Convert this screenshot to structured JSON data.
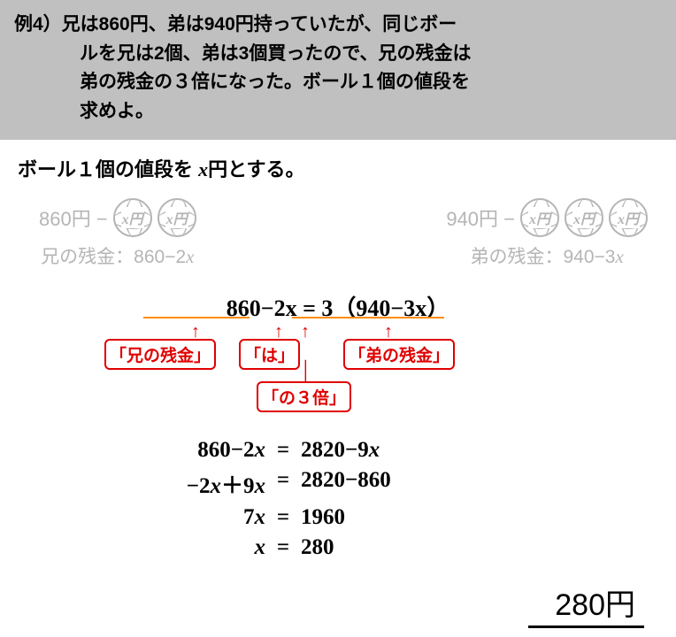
{
  "problem": {
    "label": "例4）",
    "line1": "兄は860円、弟は940円持っていたが、同じボー",
    "line2": "ルを兄は2個、弟は3個買ったので、兄の残金は",
    "line3": "弟の残金の３倍になった。ボール１個の値段を",
    "line4": "求めよ。"
  },
  "let": {
    "prefix": "ボール１個の値段を ",
    "var": "x",
    "suffix": "円とする。"
  },
  "diagram": {
    "left": {
      "start": "860円 −",
      "balls": [
        "x円",
        "x円"
      ],
      "label_pre": "兄の残金：860−2",
      "label_var": "x"
    },
    "right": {
      "start": "940円 −",
      "balls": [
        "x円",
        "x円",
        "x円"
      ],
      "label_pre": "弟の残金：940−3",
      "label_var": "x"
    }
  },
  "main_eq": "860−2x  =  3（940−3x）",
  "annotations": {
    "a1": "「兄の残金」",
    "a2": "「は」",
    "a3": "「弟の残金」",
    "a4": "「の３倍」"
  },
  "steps": [
    {
      "lhs": "860−2x",
      "rhs": "2820−9x"
    },
    {
      "lhs": "−2x＋9x",
      "rhs": "2820−860"
    },
    {
      "lhs": "7x",
      "rhs": "1960"
    },
    {
      "lhs": "x",
      "rhs": "280"
    }
  ],
  "answer": "280円"
}
